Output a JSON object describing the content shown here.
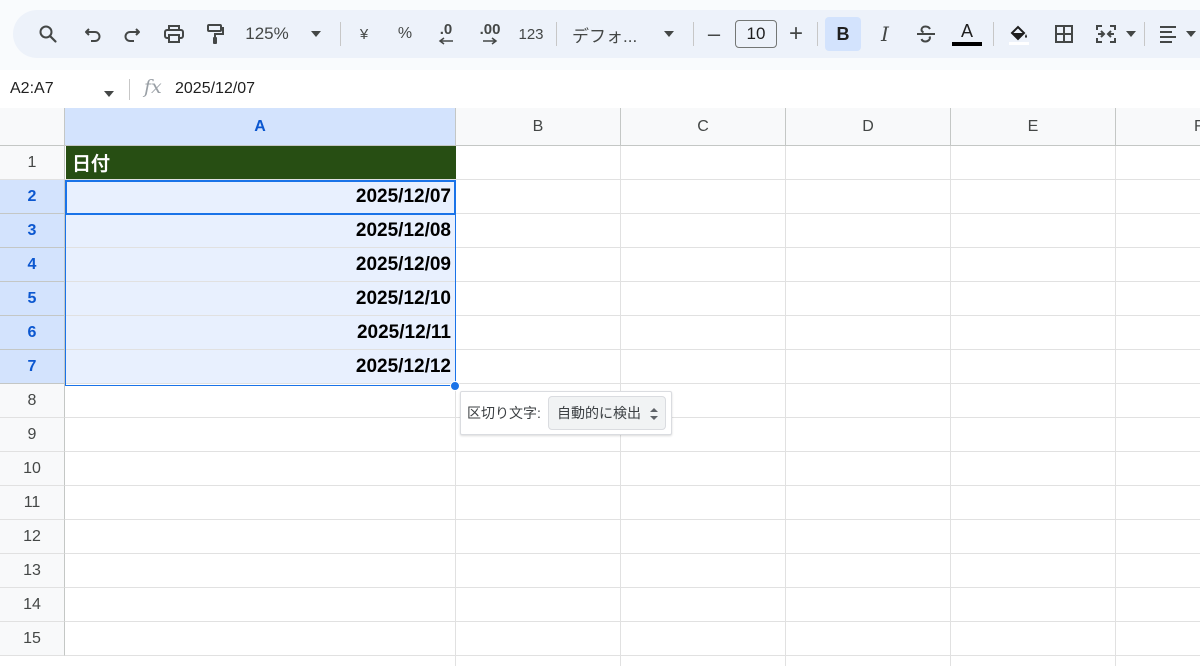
{
  "toolbar": {
    "zoom": "125%",
    "currency_label": "¥",
    "percent_label": "%",
    "dec_decrease_label": ".0",
    "dec_increase_label": ".00",
    "number_format_label": "123",
    "font_name": "デフォ...",
    "font_size": "10",
    "minus_label": "–",
    "plus_label": "+",
    "bold_label": "B",
    "italic_label": "I",
    "text_color_label": "A",
    "text_color": "#000000",
    "accent": "#d3e3fd"
  },
  "formula_bar": {
    "range": "A2:A7",
    "fx_label": "fx",
    "value": "2025/12/07"
  },
  "grid": {
    "columns": [
      "A",
      "B",
      "C",
      "D",
      "E",
      "F"
    ],
    "selected_column": "A",
    "rows": [
      "1",
      "2",
      "3",
      "4",
      "5",
      "6",
      "7",
      "8",
      "9",
      "10",
      "11",
      "12",
      "13",
      "14",
      "15"
    ],
    "header_cell": "日付",
    "header_fill": "#274e13",
    "dates": [
      "2025/12/07",
      "2025/12/08",
      "2025/12/09",
      "2025/12/10",
      "2025/12/11",
      "2025/12/12"
    ],
    "selection_color": "#1a73e8"
  },
  "split_popup": {
    "label": "区切り文字:",
    "selected": "自動的に検出"
  }
}
